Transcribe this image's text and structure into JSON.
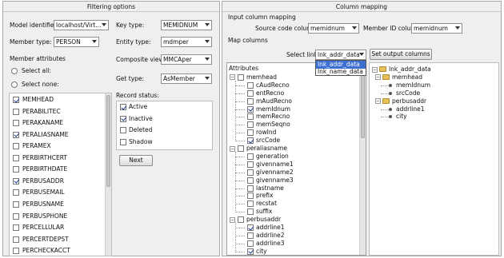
{
  "filtering": {
    "title": "Filtering options",
    "model_identifier_label": "Model identifier:",
    "model_identifier_value": "localhost/Virt...",
    "member_type_label": "Member type:",
    "member_type_value": "PERSON",
    "member_attributes_label": "Member attributes",
    "select_all": "Select all:",
    "select_none": "Select none:",
    "attributes": [
      {
        "name": "MEMHEAD",
        "checked": true
      },
      {
        "name": "PERABILITEC",
        "checked": false
      },
      {
        "name": "PERAKANAME",
        "checked": false
      },
      {
        "name": "PERALIASNAME",
        "checked": true
      },
      {
        "name": "PERAMEX",
        "checked": false
      },
      {
        "name": "PERBIRTHCERT",
        "checked": false
      },
      {
        "name": "PERBIRTHDATE",
        "checked": false
      },
      {
        "name": "PERBUSADDR",
        "checked": true
      },
      {
        "name": "PERBUSEMAIL",
        "checked": false
      },
      {
        "name": "PERBUSNAME",
        "checked": false
      },
      {
        "name": "PERBUSPHONE",
        "checked": false
      },
      {
        "name": "PERCELLULAR",
        "checked": false
      },
      {
        "name": "PERCERTDEPST",
        "checked": false
      },
      {
        "name": "PERCHECKACCT",
        "checked": false
      }
    ],
    "key_type_label": "Key type:",
    "key_type_value": "MEMIDNUM",
    "entity_type_label": "Entity type:",
    "entity_type_value": "mdmper",
    "composite_view_label": "Composite view:",
    "composite_view_value": "MMCAper",
    "get_type_label": "Get type:",
    "get_type_value": "AsMember",
    "record_status_label": "Record status:",
    "record_status": [
      {
        "name": "Active",
        "checked": true
      },
      {
        "name": "Inactive",
        "checked": true
      },
      {
        "name": "Deleted",
        "checked": false
      },
      {
        "name": "Shadow",
        "checked": false
      }
    ],
    "next_label": "Next"
  },
  "mapping": {
    "title": "Column mapping",
    "input_mapping_label": "Input column mapping",
    "source_code_label": "Source code column:",
    "source_code_value": "memidnum",
    "member_id_label": "Member ID column:",
    "member_id_value": "memidnum",
    "map_columns_label": "Map columns",
    "select_link_label": "Select link:",
    "select_link_value": "lnk_addr_data",
    "select_link_options": [
      "lnk_addr_data",
      "lnk_name_data"
    ],
    "set_output_label": "Set output columns",
    "attributes_label": "Attributes",
    "tree": [
      {
        "name": "memhead",
        "checked": false,
        "children": [
          {
            "name": "cAudRecno",
            "checked": false
          },
          {
            "name": "entRecno",
            "checked": false
          },
          {
            "name": "mAudRecno",
            "checked": false
          },
          {
            "name": "memIdnum",
            "checked": true
          },
          {
            "name": "memRecno",
            "checked": false
          },
          {
            "name": "memSeqno",
            "checked": false
          },
          {
            "name": "rowInd",
            "checked": false
          },
          {
            "name": "srcCode",
            "checked": true
          }
        ]
      },
      {
        "name": "peraliasname",
        "checked": false,
        "children": [
          {
            "name": "generation",
            "checked": false
          },
          {
            "name": "givenname1",
            "checked": false
          },
          {
            "name": "givenname2",
            "checked": false
          },
          {
            "name": "givenname3",
            "checked": false
          },
          {
            "name": "lastname",
            "checked": false
          },
          {
            "name": "prefix",
            "checked": false
          },
          {
            "name": "recstat",
            "checked": false
          },
          {
            "name": "suffix",
            "checked": false
          }
        ]
      },
      {
        "name": "perbusaddr",
        "checked": false,
        "children": [
          {
            "name": "addrline1",
            "checked": true
          },
          {
            "name": "addrline2",
            "checked": false
          },
          {
            "name": "addrline3",
            "checked": false
          },
          {
            "name": "city",
            "checked": true
          }
        ]
      }
    ],
    "output_tree": {
      "root": "lnk_addr_data",
      "groups": [
        {
          "name": "memhead",
          "children": [
            "memIdnum",
            "srcCode"
          ]
        },
        {
          "name": "perbusaddr",
          "children": [
            "addrline1",
            "city"
          ]
        }
      ]
    }
  }
}
